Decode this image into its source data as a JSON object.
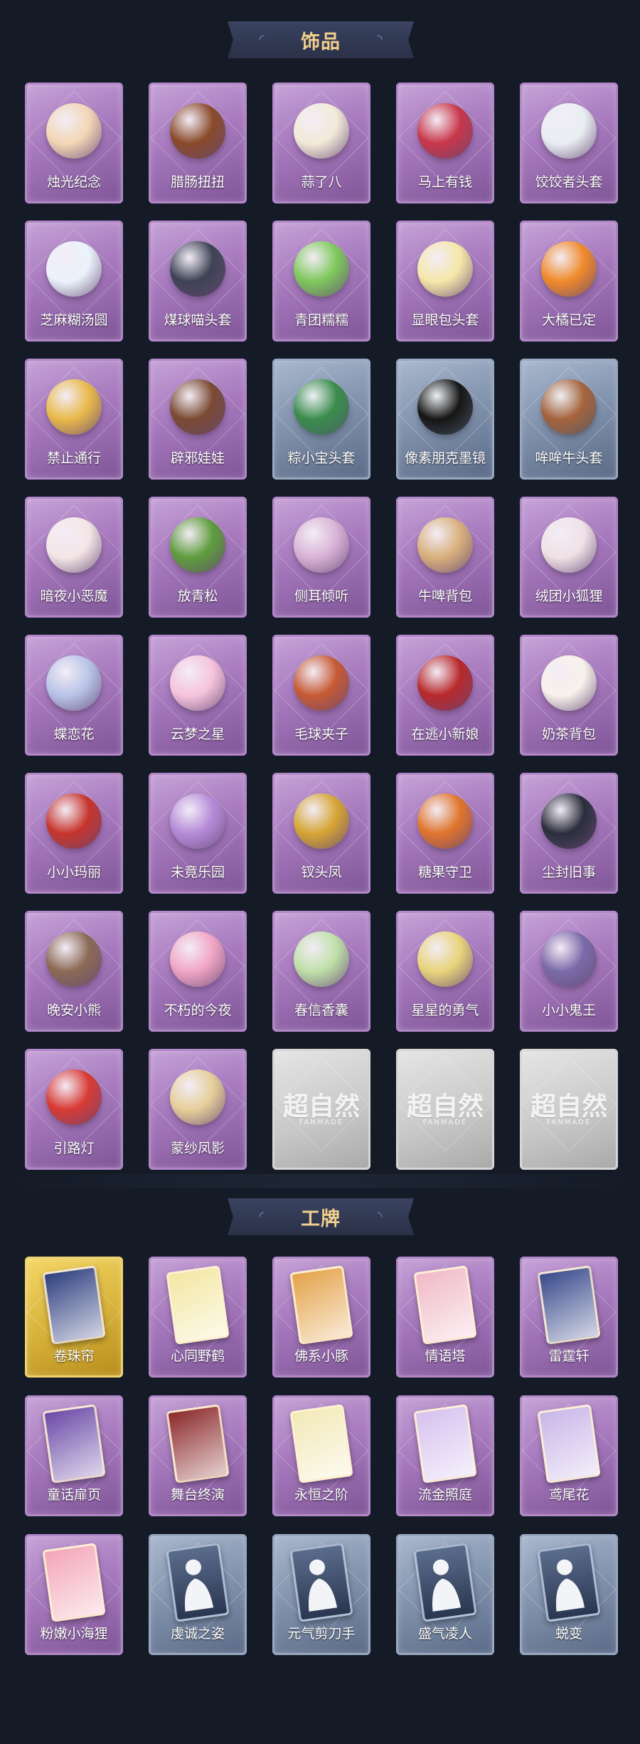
{
  "accessories": {
    "title": "饰品",
    "items": [
      {
        "label": "烛光纪念",
        "icon": "candle-icon",
        "color": "#f3d6b5",
        "style": "purple"
      },
      {
        "label": "腊肠扭扭",
        "icon": "dachshund-icon",
        "color": "#8a4a2a",
        "style": "purple"
      },
      {
        "label": "蒜了八",
        "icon": "garlic-icon",
        "color": "#f2ead8",
        "style": "purple"
      },
      {
        "label": "马上有钱",
        "icon": "horse-head-icon",
        "color": "#c8364a",
        "style": "purple"
      },
      {
        "label": "饺饺者头套",
        "icon": "dumpling-head-icon",
        "color": "#e9eef2",
        "style": "purple"
      },
      {
        "label": "芝麻糊汤圆",
        "icon": "tangyuan-icon",
        "color": "#eaf3fb",
        "style": "purple"
      },
      {
        "label": "煤球喵头套",
        "icon": "cat-head-icon",
        "color": "#3d4254",
        "style": "purple"
      },
      {
        "label": "青团糯糯",
        "icon": "green-dumpling-icon",
        "color": "#7ec85c",
        "style": "purple"
      },
      {
        "label": "显眼包头套",
        "icon": "lightbulb-head-icon",
        "color": "#f5e8a8",
        "style": "purple"
      },
      {
        "label": "大橘已定",
        "icon": "orange-slice-icon",
        "color": "#f08a2a",
        "style": "purple"
      },
      {
        "label": "禁止通行",
        "icon": "traffic-cone-icon",
        "color": "#e9b94a",
        "style": "purple"
      },
      {
        "label": "辟邪娃娃",
        "icon": "doll-head-icon",
        "color": "#7a4a32",
        "style": "purple"
      },
      {
        "label": "粽小宝头套",
        "icon": "zongzi-head-icon",
        "color": "#3a8c4c",
        "style": "blue"
      },
      {
        "label": "像素朋克墨镜",
        "icon": "pixel-sunglasses-icon",
        "color": "#151515",
        "style": "blue"
      },
      {
        "label": "哞哞牛头套",
        "icon": "cow-head-icon",
        "color": "#a5633c",
        "style": "blue"
      },
      {
        "label": "暗夜小恶魔",
        "icon": "little-devil-icon",
        "color": "#f4e6e6",
        "style": "purple"
      },
      {
        "label": "放青松",
        "icon": "bonsai-pine-icon",
        "color": "#5e9c3c",
        "style": "purple"
      },
      {
        "label": "侧耳倾听",
        "icon": "lotus-earring-icon",
        "color": "#d9b3d6",
        "style": "purple"
      },
      {
        "label": "牛啤背包",
        "icon": "beer-mug-backpack-icon",
        "color": "#d9b07c",
        "style": "purple"
      },
      {
        "label": "绒团小狐狸",
        "icon": "fox-plush-icon",
        "color": "#f0e2e6",
        "style": "purple"
      },
      {
        "label": "蝶恋花",
        "icon": "butterfly-bell-icon",
        "color": "#b8c4e8",
        "style": "purple"
      },
      {
        "label": "云梦之星",
        "icon": "unicorn-cloud-icon",
        "color": "#f6c4dc",
        "style": "purple"
      },
      {
        "label": "毛球夹子",
        "icon": "red-panda-clip-icon",
        "color": "#c65a34",
        "style": "purple"
      },
      {
        "label": "在逃小新娘",
        "icon": "bride-veil-icon",
        "color": "#b8282c",
        "style": "purple"
      },
      {
        "label": "奶茶背包",
        "icon": "milk-tea-backpack-icon",
        "color": "#f7f2ea",
        "style": "purple"
      },
      {
        "label": "小小玛丽",
        "icon": "mary-doll-icon",
        "color": "#c6342c",
        "style": "purple"
      },
      {
        "label": "未竟乐园",
        "icon": "jester-doll-icon",
        "color": "#b58bd8",
        "style": "purple"
      },
      {
        "label": "钗头凤",
        "icon": "phoenix-crown-icon",
        "color": "#d6a534",
        "style": "purple"
      },
      {
        "label": "糖果守卫",
        "icon": "pumpkin-guard-icon",
        "color": "#e0742c",
        "style": "purple"
      },
      {
        "label": "尘封旧事",
        "icon": "gentleman-charm-icon",
        "color": "#2a2e3c",
        "style": "purple"
      },
      {
        "label": "晚安小熊",
        "icon": "teddy-bear-icon",
        "color": "#8b6a55",
        "style": "purple"
      },
      {
        "label": "不朽的今夜",
        "icon": "pink-cat-charm-icon",
        "color": "#f1a6c4",
        "style": "purple"
      },
      {
        "label": "春信香囊",
        "icon": "sachet-icon",
        "color": "#bfe0a8",
        "style": "purple"
      },
      {
        "label": "星星的勇气",
        "icon": "star-boy-charm-icon",
        "color": "#e8d47a",
        "style": "purple"
      },
      {
        "label": "小小鬼王",
        "icon": "ghost-king-charm-icon",
        "color": "#7a6aa8",
        "style": "purple"
      },
      {
        "label": "引路灯",
        "icon": "lantern-icon",
        "color": "#d83a34",
        "style": "purple"
      },
      {
        "label": "蒙纱凤影",
        "icon": "veiled-phoenix-icon",
        "color": "#e6cf9a",
        "style": "purple"
      },
      {
        "label": "",
        "icon": "placeholder-logo-icon",
        "color": "#d0d0d0",
        "style": "empty",
        "logo": "超自然",
        "logo_sub": "FANMADE"
      },
      {
        "label": "",
        "icon": "placeholder-logo-icon",
        "color": "#d0d0d0",
        "style": "empty",
        "logo": "超自然",
        "logo_sub": "FANMADE"
      },
      {
        "label": "",
        "icon": "placeholder-logo-icon",
        "color": "#d0d0d0",
        "style": "empty",
        "logo": "超自然",
        "logo_sub": "FANMADE"
      }
    ]
  },
  "badges": {
    "title": "工牌",
    "items": [
      {
        "label": "卷珠帘",
        "icon": "badge-card-icon",
        "color": "#2f3f80",
        "style": "gold"
      },
      {
        "label": "心同野鹤",
        "icon": "badge-card-icon",
        "color": "#f3e7a2",
        "style": "purple"
      },
      {
        "label": "佛系小豚",
        "icon": "badge-card-icon",
        "color": "#e4a34a",
        "style": "purple"
      },
      {
        "label": "情语塔",
        "icon": "badge-card-icon",
        "color": "#f1b9c8",
        "style": "purple"
      },
      {
        "label": "雷霆轩",
        "icon": "badge-card-icon",
        "color": "#3a4a8c",
        "style": "purple"
      },
      {
        "label": "童话扉页",
        "icon": "badge-card-icon",
        "color": "#6b4aa8",
        "style": "purple"
      },
      {
        "label": "舞台终演",
        "icon": "badge-card-icon",
        "color": "#8c2a2c",
        "style": "purple"
      },
      {
        "label": "永恒之阶",
        "icon": "badge-card-icon",
        "color": "#f3e9b8",
        "style": "purple"
      },
      {
        "label": "流金照庭",
        "icon": "badge-card-icon",
        "color": "#d6c1ef",
        "style": "purple"
      },
      {
        "label": "鸢尾花",
        "icon": "badge-card-icon",
        "color": "#c9b6e8",
        "style": "purple"
      },
      {
        "label": "粉嫩小海狸",
        "icon": "badge-card-icon",
        "color": "#f3a6b8",
        "style": "purple"
      },
      {
        "label": "虔诚之姿",
        "icon": "silhouette-icon",
        "color": "#3a4a68",
        "style": "blue"
      },
      {
        "label": "元气剪刀手",
        "icon": "silhouette-icon",
        "color": "#3a4a68",
        "style": "blue"
      },
      {
        "label": "盛气凌人",
        "icon": "silhouette-icon",
        "color": "#3a4a68",
        "style": "blue"
      },
      {
        "label": "蜕变",
        "icon": "silhouette-icon",
        "color": "#3a4a68",
        "style": "blue"
      }
    ]
  }
}
